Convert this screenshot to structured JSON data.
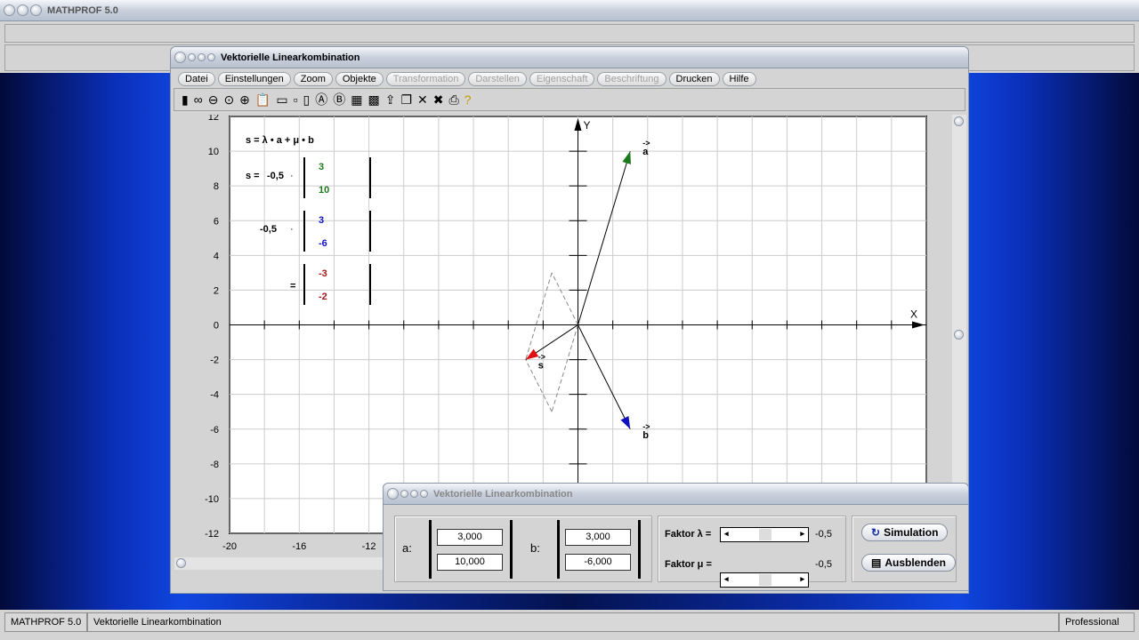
{
  "app": {
    "title": "MATHPROF 5.0"
  },
  "window": {
    "title": "Vektorielle Linearkombination",
    "menu": [
      {
        "label": "Datei",
        "enabled": true
      },
      {
        "label": "Einstellungen",
        "enabled": true
      },
      {
        "label": "Zoom",
        "enabled": true
      },
      {
        "label": "Objekte",
        "enabled": true
      },
      {
        "label": "Transformation",
        "enabled": false
      },
      {
        "label": "Darstellen",
        "enabled": false
      },
      {
        "label": "Eigenschaft",
        "enabled": false
      },
      {
        "label": "Beschriftung",
        "enabled": false
      },
      {
        "label": "Drucken",
        "enabled": true
      },
      {
        "label": "Hilfe",
        "enabled": true
      }
    ],
    "toolbar": [
      "switch-icon",
      "glasses-icon",
      "zoom-out-icon",
      "zoom-reset-icon",
      "zoom-in-icon",
      "clipboard-icon",
      "window-icon",
      "small-box-icon",
      "boxes-icon",
      "circle-a-icon",
      "circle-b-icon",
      "table-icon",
      "chart-icon",
      "export-icon",
      "pages-icon",
      "cross-icon",
      "cross2-icon",
      "print-icon",
      "help-icon"
    ]
  },
  "formula": {
    "header": "s = λ • a + μ • b",
    "s_label": "s =",
    "lambda": "-0,5",
    "mu": "-0,5",
    "dot": "·",
    "eq": "=",
    "a": [
      "3",
      "10"
    ],
    "b": [
      "3",
      "-6"
    ],
    "s": [
      "-3",
      "-2"
    ]
  },
  "chart_data": {
    "type": "vector-plot",
    "xlim": [
      -20,
      20
    ],
    "ylim": [
      -12,
      12
    ],
    "grid": true,
    "xlabel": "X",
    "ylabel": "Y",
    "xticks": [
      -20,
      -16,
      -12
    ],
    "yticks": [
      12,
      10,
      8,
      6,
      4,
      2,
      0,
      -2,
      -4,
      -6,
      -8,
      -10,
      -12
    ],
    "vectors": [
      {
        "name": "a",
        "x": 3,
        "y": 10,
        "color": "#1a7a1a"
      },
      {
        "name": "b",
        "x": 3,
        "y": -6,
        "color": "#1010c0"
      },
      {
        "name": "s",
        "x": -3,
        "y": -2,
        "color": "#e01010"
      }
    ],
    "construction": [
      {
        "x": -1.5,
        "y": -5
      },
      {
        "x": -1.5,
        "y": 3
      }
    ]
  },
  "dialog": {
    "title": "Vektorielle Linearkombination",
    "a_label": "a:",
    "b_label": "b:",
    "a": [
      "3,000",
      "10,000"
    ],
    "b": [
      "3,000",
      "-6,000"
    ],
    "lambda_label": "Faktor λ =",
    "mu_label": "Faktor μ =",
    "lambda_value": "-0,5",
    "mu_value": "-0,5",
    "lambda_slider": 0.5,
    "mu_slider": 0.5,
    "simulation": "Simulation",
    "hide": "Ausblenden"
  },
  "status": {
    "app": "MATHPROF 5.0",
    "doc": "Vektorielle Linearkombination",
    "edition": "Professional"
  }
}
